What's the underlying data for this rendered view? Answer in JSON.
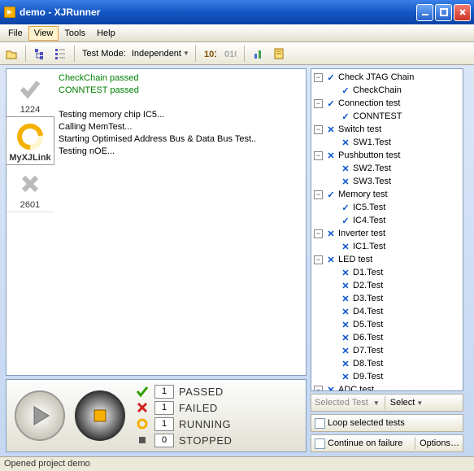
{
  "window": {
    "title": "demo - XJRunner"
  },
  "menubar": [
    "File",
    "View",
    "Tools",
    "Help"
  ],
  "menubar_active_index": 1,
  "toolbar": {
    "test_mode_label": "Test Mode:",
    "test_mode_value": "Independent"
  },
  "status_items": [
    {
      "label": "1224",
      "active": false,
      "type": "check"
    },
    {
      "label": "MyXJLink",
      "active": true,
      "type": "running"
    },
    {
      "label": "2601",
      "active": false,
      "type": "x"
    }
  ],
  "log_lines": [
    {
      "text": "CheckChain passed",
      "class": "log-green"
    },
    {
      "text": "CONNTEST passed",
      "class": "log-green"
    },
    {
      "text": "",
      "class": "log-black"
    },
    {
      "text": "Testing memory chip IC5...",
      "class": "log-black"
    },
    {
      "text": "Calling MemTest...",
      "class": "log-black"
    },
    {
      "text": "Starting Optimised Address Bus & Data Bus Test..",
      "class": "log-black"
    },
    {
      "text": "Testing nOE...",
      "class": "log-black"
    }
  ],
  "stats": [
    {
      "icon": "check",
      "color": "#2aa000",
      "count": "1",
      "label": "PASSED"
    },
    {
      "icon": "x",
      "color": "#d02020",
      "count": "1",
      "label": "FAILED"
    },
    {
      "icon": "spin",
      "color": "#f5b000",
      "count": "1",
      "label": "RUNNING"
    },
    {
      "icon": "stop",
      "color": "#555",
      "count": "0",
      "label": "STOPPED"
    }
  ],
  "tree": [
    {
      "depth": 0,
      "toggle": "-",
      "icon": "✓",
      "label": "Check JTAG Chain"
    },
    {
      "depth": 1,
      "icon": "✓",
      "label": "CheckChain"
    },
    {
      "depth": 0,
      "toggle": "-",
      "icon": "✓",
      "label": "Connection test"
    },
    {
      "depth": 1,
      "icon": "✓",
      "label": "CONNTEST"
    },
    {
      "depth": 0,
      "toggle": "-",
      "icon": "✕",
      "label": "Switch test"
    },
    {
      "depth": 1,
      "icon": "✕",
      "label": "SW1.Test"
    },
    {
      "depth": 0,
      "toggle": "-",
      "icon": "✕",
      "label": "Pushbutton test"
    },
    {
      "depth": 1,
      "icon": "✕",
      "label": "SW2.Test"
    },
    {
      "depth": 1,
      "icon": "✕",
      "label": "SW3.Test"
    },
    {
      "depth": 0,
      "toggle": "-",
      "icon": "✓",
      "label": "Memory test"
    },
    {
      "depth": 1,
      "icon": "✓",
      "label": "IC5.Test"
    },
    {
      "depth": 1,
      "icon": "✓",
      "label": "IC4.Test"
    },
    {
      "depth": 0,
      "toggle": "-",
      "icon": "✕",
      "label": "Inverter test"
    },
    {
      "depth": 1,
      "icon": "✕",
      "label": "IC1.Test"
    },
    {
      "depth": 0,
      "toggle": "-",
      "icon": "✕",
      "label": "LED test"
    },
    {
      "depth": 1,
      "icon": "✕",
      "label": "D1.Test"
    },
    {
      "depth": 1,
      "icon": "✕",
      "label": "D2.Test"
    },
    {
      "depth": 1,
      "icon": "✕",
      "label": "D3.Test"
    },
    {
      "depth": 1,
      "icon": "✕",
      "label": "D4.Test"
    },
    {
      "depth": 1,
      "icon": "✕",
      "label": "D5.Test"
    },
    {
      "depth": 1,
      "icon": "✕",
      "label": "D6.Test"
    },
    {
      "depth": 1,
      "icon": "✕",
      "label": "D7.Test"
    },
    {
      "depth": 1,
      "icon": "✕",
      "label": "D8.Test"
    },
    {
      "depth": 1,
      "icon": "✕",
      "label": "D9.Test"
    },
    {
      "depth": 0,
      "toggle": "-",
      "icon": "✕",
      "label": "ADC test"
    }
  ],
  "sel_bar": {
    "label": "Selected Test",
    "select": "Select"
  },
  "opts": {
    "loop": "Loop selected tests",
    "cont": "Continue on failure",
    "options": "Options…"
  },
  "statusbar": "Opened project demo"
}
